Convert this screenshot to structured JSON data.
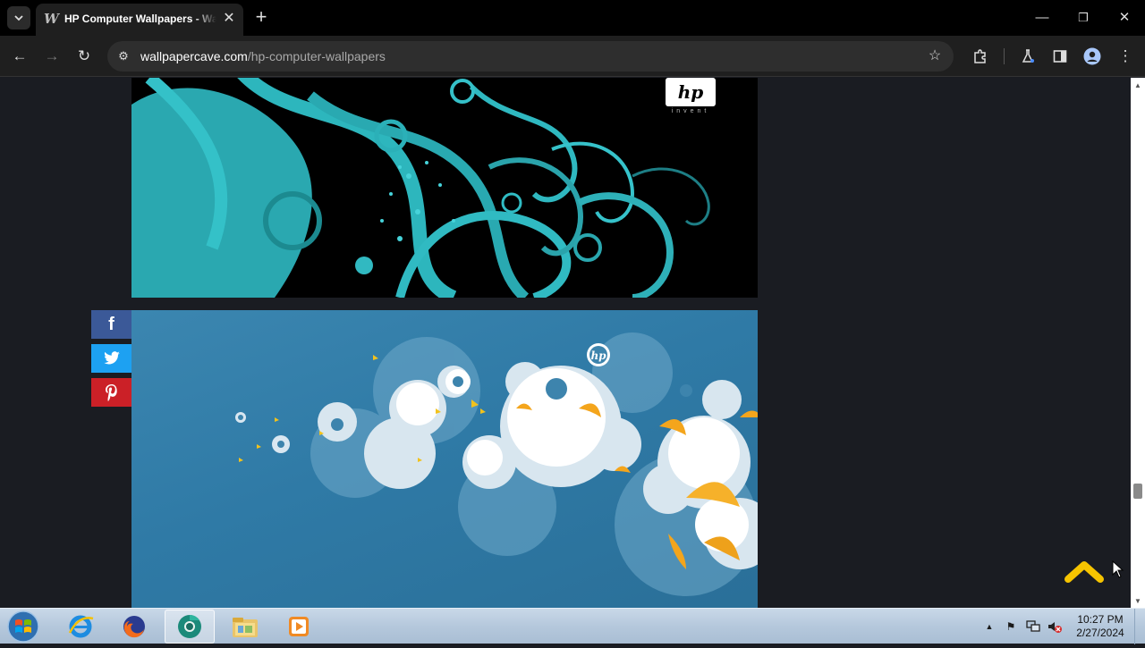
{
  "browser": {
    "tab_title": "HP Computer Wallpapers - Wallpaper Cave",
    "url_domain": "wallpapercave.com",
    "url_path": "/hp-computer-wallpapers",
    "icons": [
      "tab-search-icon",
      "favicon-w-icon",
      "close-icon",
      "new-tab-plus-icon",
      "minimize-icon",
      "restore-icon",
      "close-window-icon",
      "back-icon",
      "forward-icon",
      "reload-icon",
      "site-info-icon",
      "bookmark-star-icon",
      "extensions-icon",
      "labs-flask-icon",
      "side-panel-icon",
      "profile-icon",
      "menu-dots-icon"
    ]
  },
  "page": {
    "wallpapers": [
      {
        "name": "hp-teal-swirl-wallpaper",
        "logo_caption": "invent"
      },
      {
        "name": "hp-blue-bubbles-wallpaper"
      }
    ],
    "share": {
      "facebook": "f",
      "twitter": "twitter-bird",
      "pinterest": "p"
    },
    "colors": {
      "background": "#1a1c22",
      "scroll_top": "#f6c400",
      "facebook": "#3b5998",
      "twitter": "#1da1f2",
      "pinterest": "#cb2027"
    }
  },
  "taskbar": {
    "apps": [
      "start-orb",
      "internet-explorer",
      "firefox",
      "chrome-canary",
      "file-explorer",
      "media-player"
    ],
    "clock_time": "10:27 PM",
    "clock_date": "2/27/2024"
  }
}
